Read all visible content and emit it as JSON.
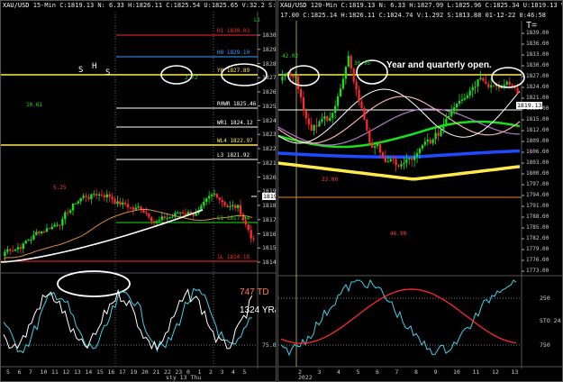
{
  "left_chart": {
    "header": {
      "symbol": "XAU/USD",
      "timeframe": "15-Min",
      "stats": "C:1819.13  N:  6.33  H:1826.11  C:1825.54  U:1825.65  V:32.2  S:19.31  01-12-22  1:58"
    },
    "price_ticks": [
      "1830",
      "1829",
      "1828",
      "1827",
      "1826",
      "1825",
      "1824",
      "1823",
      "1822",
      "1821",
      "1820",
      "1819",
      "1818",
      "1817",
      "1816",
      "1815",
      "1814"
    ],
    "current_price": "1819",
    "time_ticks": [
      "5",
      "6",
      "7",
      "10",
      "11",
      "12",
      "13",
      "14",
      "15",
      "16",
      "17",
      "19",
      "20",
      "21",
      "22",
      "23",
      "0",
      "1",
      "2",
      "3",
      "4",
      "5"
    ],
    "date_label": "sty 13 Thu",
    "level_labels": [
      {
        "text": "R1 1830.03",
        "color": "#ff2a2a"
      },
      {
        "text": "HO 1829.10",
        "color": "#3aa0ff"
      },
      {
        "text": "YH 1827.89",
        "color": "#ffe94d"
      },
      {
        "text": "R0WR 1825.46",
        "color": "#ffffff"
      },
      {
        "text": "WR1 1824.12",
        "color": "#ffffff"
      },
      {
        "text": "WL4 1822.97",
        "color": "#ffe94d"
      },
      {
        "text": "L3 1821.92",
        "color": "#ffffff"
      },
      {
        "text": "S1 1817.44",
        "color": "#19e01c"
      },
      {
        "text": "1L 1814.18",
        "color": "#ff2a2a"
      }
    ],
    "small_labels": [
      {
        "text": "10.61",
        "color": "#19e01c"
      },
      {
        "text": "5.25",
        "color": "#ff4040"
      },
      {
        "text": "2.72",
        "color": "#19e01c"
      },
      {
        "text": "S",
        "color": "#ffffff"
      },
      {
        "text": "H",
        "color": "#ffffff"
      },
      {
        "text": "S",
        "color": "#ffffff"
      }
    ],
    "oscillator": {
      "labels": [
        "747 TD",
        "1324 YRan",
        "75.00"
      ],
      "colors": {
        "td": "#ff8030",
        "yran": "#ffffff"
      }
    }
  },
  "right_chart": {
    "header": {
      "symbol": "XAU/USD",
      "timeframe": "120-Min",
      "stats": "C:1819.13  N:  6.33  H:1827.99  L:1825.96  C:1825.34  U:1819.13  V:22.0K",
      "sub": "17.00  C:1825.14  H:1826.11  C:1824.74  V:1.292  S:1813.88  01-12-22  0:46:58"
    },
    "price_ticks": [
      "1839.00",
      "1836.00",
      "1833.00",
      "1830.00",
      "1827.00",
      "1824.00",
      "1821.00",
      "1818.00",
      "1815.00",
      "1812.00",
      "1809.00",
      "1806.00",
      "1803.00",
      "1800.00",
      "1797.00",
      "1794.00",
      "1791.00",
      "1788.00",
      "1785.00",
      "1782.00",
      "1779.00",
      "1776.00",
      "1773.00"
    ],
    "current_price": "1819.13",
    "time_ticks": [
      "2",
      "3",
      "4",
      "5",
      "6",
      "7",
      "8",
      "9",
      "10",
      "11",
      "12",
      "13"
    ],
    "year_label": "2022",
    "annotation": "Year and quarterly open.",
    "corner_label": "T=",
    "small_labels": [
      {
        "text": "42.02",
        "color": "#19e01c"
      },
      {
        "text": "30.95",
        "color": "#19e01c"
      },
      {
        "text": "23.00",
        "color": "#ff4040"
      },
      {
        "text": "46.90",
        "color": "#ff4040"
      }
    ],
    "oscillator": {
      "labels": [
        "250",
        "STO 24",
        "750"
      ]
    }
  },
  "colors": {
    "bull": "#19e01c",
    "bear": "#ff2a2a",
    "yellow": "#ffe94d",
    "blue": "#1e4bff",
    "ma_orange": "#e08a3c",
    "ma_white": "#ffffff"
  }
}
